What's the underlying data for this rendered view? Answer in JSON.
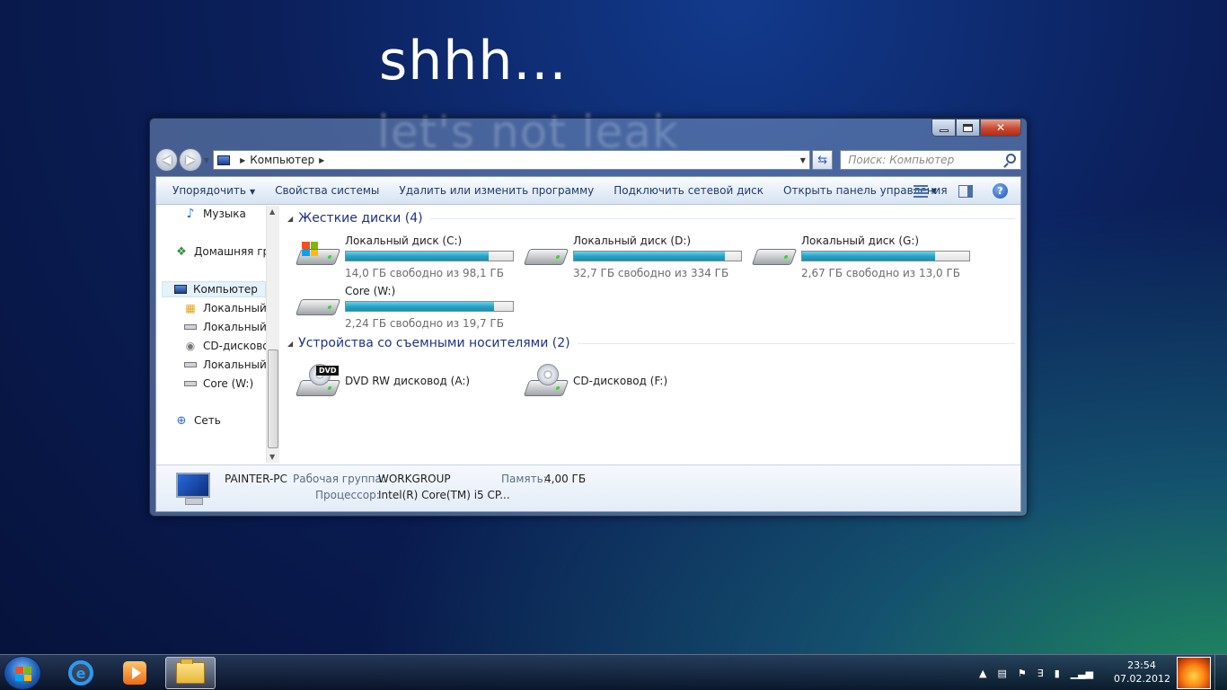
{
  "wallpaper": {
    "headline": "shhh...",
    "subline": "let's not leak"
  },
  "window": {
    "address": {
      "crumb": "Компьютер"
    },
    "search": {
      "placeholder": "Поиск: Компьютер"
    },
    "toolbar": {
      "organize": "Упорядочить",
      "system_properties": "Свойства системы",
      "uninstall": "Удалить или изменить программу",
      "map_drive": "Подключить сетевой диск",
      "control_panel": "Открыть панель управления"
    },
    "nav_pane": {
      "items": [
        {
          "label": "Музыка",
          "icon": "music-icon"
        },
        {
          "label": "Домашняя гру",
          "icon": "homegroup-icon"
        },
        {
          "label": "Компьютер",
          "icon": "computer-icon"
        },
        {
          "label": "Локальный д",
          "icon": "system-drive-icon"
        },
        {
          "label": "Локальный д",
          "icon": "drive-icon"
        },
        {
          "label": "CD-дисковод",
          "icon": "cd-drive-icon"
        },
        {
          "label": "Локальный д",
          "icon": "drive-icon"
        },
        {
          "label": "Core (W:)",
          "icon": "drive-icon"
        },
        {
          "label": "Сеть",
          "icon": "network-icon"
        }
      ]
    },
    "hard_drives": {
      "title": "Жесткие диски (4)",
      "drives": [
        {
          "name": "Локальный диск (C:)",
          "free": "14,0 ГБ свободно из 98,1 ГБ",
          "used_fraction": 0.857,
          "system": true
        },
        {
          "name": "Локальный диск (D:)",
          "free": "32,7 ГБ свободно из 334 ГБ",
          "used_fraction": 0.902,
          "system": false
        },
        {
          "name": "Локальный диск (G:)",
          "free": "2,67 ГБ свободно из 13,0 ГБ",
          "used_fraction": 0.795,
          "system": false
        },
        {
          "name": "Core (W:)",
          "free": "2,24 ГБ свободно из 19,7 ГБ",
          "used_fraction": 0.886,
          "system": false
        }
      ]
    },
    "removable": {
      "title": "Устройства со съемными носителями (2)",
      "devices": [
        {
          "name": "DVD RW дисковод (A:)",
          "badge": "DVD"
        },
        {
          "name": "CD-дисковод (F:)"
        }
      ]
    },
    "details": {
      "computer_name": "PAINTER-PC",
      "workgroup_label": "Рабочая группа:",
      "workgroup_value": "WORKGROUP",
      "memory_label": "Память:",
      "memory_value": "4,00 ГБ",
      "cpu_label": "Процессор:",
      "cpu_value": "Intel(R) Core(TM) i5 CP..."
    }
  },
  "taskbar": {
    "clock_time": "23:54",
    "clock_date": "07.02.2012"
  },
  "colors": {
    "link_blue": "#1e3287",
    "bar_fill": "#27a5c8",
    "win_red": "#f25022",
    "win_green": "#7fba00",
    "win_blue": "#00a4ef",
    "win_yellow": "#ffb900"
  }
}
